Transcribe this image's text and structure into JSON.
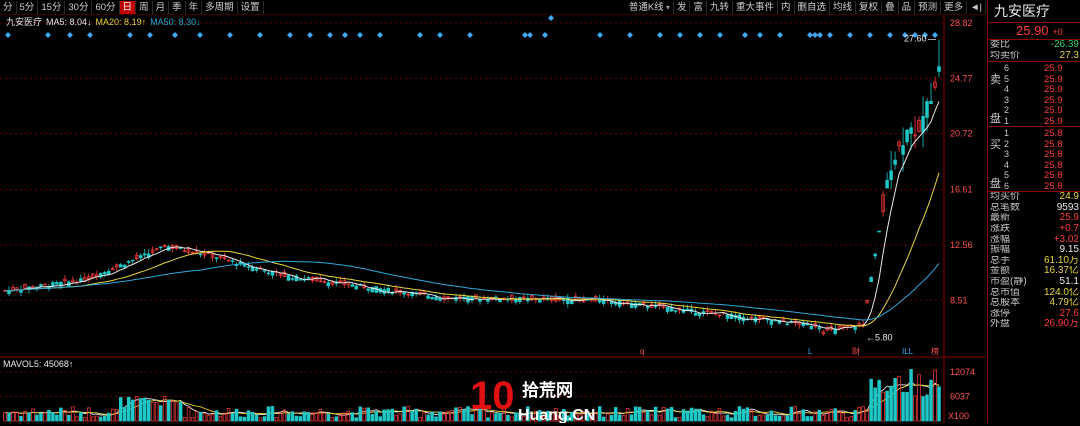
{
  "toolbar": {
    "periods": [
      "分",
      "5分",
      "15分",
      "30分",
      "60分",
      "日",
      "周",
      "月",
      "季",
      "年",
      "多周期",
      "设置"
    ],
    "active_period": "日",
    "main_dropdown": "普通K线",
    "right_items": [
      "发",
      "富",
      "九转",
      "重大事件",
      "内",
      "删自选",
      "均线",
      "复权",
      "叠",
      "品",
      "预测",
      "更多"
    ]
  },
  "indicator": {
    "stock_name": "九安医疗",
    "ma5_label": "MA5: 8.04↓",
    "ma20_label": "MA20: 8.19↑",
    "ma50_label": "MA50: 8.30↓"
  },
  "colors": {
    "up": "#ff3b3b",
    "down": "#1ec8c8",
    "ma5": "#e8e8e8",
    "ma20": "#e8d63a",
    "ma50": "#2ea8d8",
    "grid": "#7a0000",
    "marker": "#3fa9f5"
  },
  "price_axis": [
    "28.82",
    "24.77",
    "20.72",
    "16.61",
    "12.56",
    "8.51"
  ],
  "price_range": [
    4.5,
    28.82
  ],
  "annotations": {
    "high": "27.60",
    "low": "5.80",
    "bottom_markers": [
      "q",
      "L",
      "财",
      "ILL",
      "榜"
    ]
  },
  "volume": {
    "label": "MAVOL5: 45068↑",
    "axis": [
      "12074",
      "6037"
    ],
    "unit": "X100"
  },
  "watermark": {
    "main": "拾荒网",
    "sub": "Huang.CN",
    "digits": "10"
  },
  "panel": {
    "stock_name": "九安医疗",
    "price": "25.90",
    "price_change_partial": "+0",
    "wei_bi": {
      "label": "委比",
      "value": "-26.39"
    },
    "jun_mai_jia": {
      "label": "均卖价",
      "value": "27.3"
    },
    "sell_side": "卖盘",
    "buy_side": "买盘",
    "sell_levels": [
      {
        "lvl": "6",
        "p": "25.9"
      },
      {
        "lvl": "5",
        "p": "25.9"
      },
      {
        "lvl": "4",
        "p": "25.9"
      },
      {
        "lvl": "3",
        "p": "25.9"
      },
      {
        "lvl": "2",
        "p": "25.9"
      },
      {
        "lvl": "1",
        "p": "25.9"
      }
    ],
    "buy_levels": [
      {
        "lvl": "1",
        "p": "25.8"
      },
      {
        "lvl": "2",
        "p": "25.8"
      },
      {
        "lvl": "3",
        "p": "25.8"
      },
      {
        "lvl": "4",
        "p": "25.8"
      },
      {
        "lvl": "5",
        "p": "25.8"
      },
      {
        "lvl": "6",
        "p": "25.8"
      }
    ],
    "stats": [
      {
        "k": "均买价",
        "v": "24.9",
        "c": "yel"
      },
      {
        "k": "总笔数",
        "v": "9593",
        "c": "white"
      },
      {
        "k": "最新",
        "v": "25.9",
        "c": "red"
      },
      {
        "k": "涨跌",
        "v": "+0.7",
        "c": "red"
      },
      {
        "k": "涨幅",
        "v": "+3.02",
        "c": "red"
      },
      {
        "k": "振幅",
        "v": "9.15",
        "c": "white"
      },
      {
        "k": "总手",
        "v": "61.10万",
        "c": "yel"
      },
      {
        "k": "金额",
        "v": "16.37亿",
        "c": "yel"
      },
      {
        "k": "市盈(静)",
        "v": "51.1",
        "c": "white"
      },
      {
        "k": "总市值",
        "v": "124.0亿",
        "c": "yel"
      },
      {
        "k": "总股本",
        "v": "4.79亿",
        "c": "yel"
      },
      {
        "k": "涨停",
        "v": "27.6",
        "c": "red"
      },
      {
        "k": "外盘",
        "v": "26.90万",
        "c": "red"
      }
    ]
  }
}
